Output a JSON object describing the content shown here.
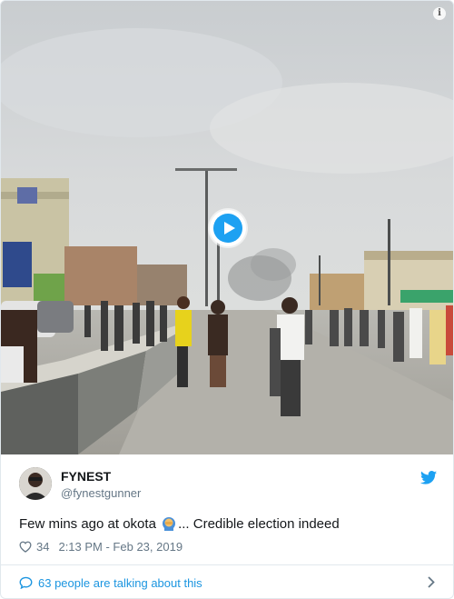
{
  "tweet": {
    "display_name": "FYNEST",
    "handle": "@fynestgunner",
    "text_before_emoji": "Few mins ago at okota ",
    "emoji_icon": "person-facepalming-emoji",
    "text_after_emoji": "... Credible election indeed",
    "like_count": "34",
    "timestamp": "2:13 PM - Feb 23, 2019"
  },
  "conversation": {
    "label": "63 people are talking about this"
  },
  "colors": {
    "brand_blue": "#1da1f2",
    "link_blue": "#1b95e0",
    "muted": "#657786",
    "text": "#14171a",
    "border": "#e1e8ed"
  },
  "icons": {
    "info": "info-icon",
    "play": "play-icon",
    "bird": "twitter-bird-icon",
    "like": "heart-icon",
    "conversation": "speech-bubble-icon",
    "more": "chevron-right-icon"
  }
}
